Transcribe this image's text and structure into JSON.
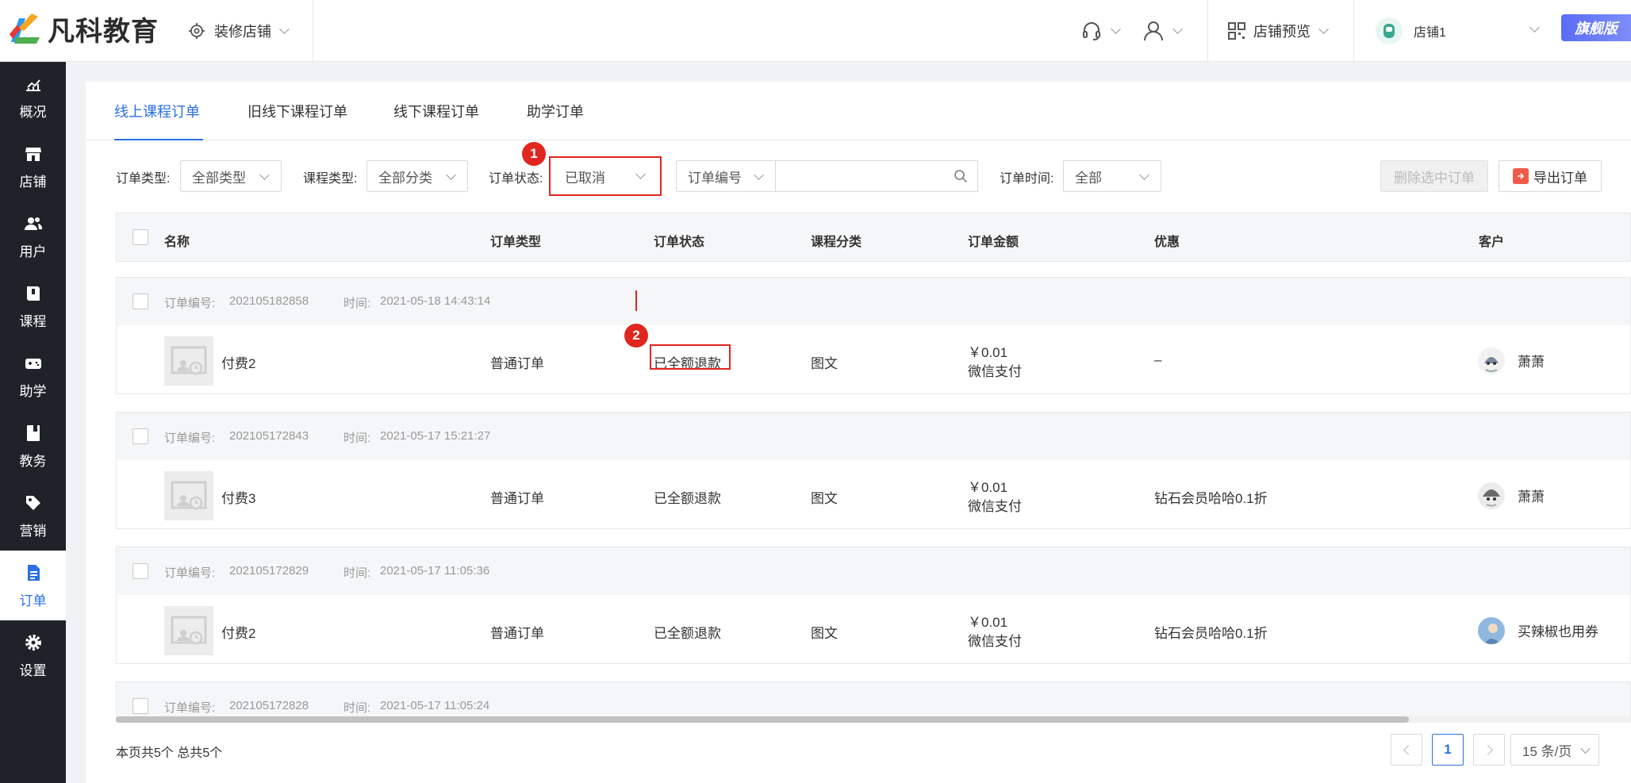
{
  "header": {
    "brand": "凡科教育",
    "decorate_label": "装修店铺",
    "store_preview_label": "店铺预览",
    "store_name": "店铺1",
    "edition_badge": "旗舰版"
  },
  "sidebar": {
    "items": [
      {
        "label": "概况",
        "icon": "chart-icon"
      },
      {
        "label": "店铺",
        "icon": "store-icon"
      },
      {
        "label": "用户",
        "icon": "users-icon"
      },
      {
        "label": "课程",
        "icon": "book-icon"
      },
      {
        "label": "助学",
        "icon": "gamepad-icon"
      },
      {
        "label": "教务",
        "icon": "notebook-icon"
      },
      {
        "label": "营销",
        "icon": "tag-icon"
      },
      {
        "label": "订单",
        "icon": "document-icon"
      },
      {
        "label": "设置",
        "icon": "gear-icon"
      }
    ],
    "active": "订单"
  },
  "tabs": [
    "线上课程订单",
    "旧线下课程订单",
    "线下课程订单",
    "助学订单"
  ],
  "filters": {
    "order_type_label": "订单类型:",
    "order_type_value": "全部类型",
    "course_type_label": "课程类型:",
    "course_type_value": "全部分类",
    "order_status_label": "订单状态:",
    "order_status_value": "已取消",
    "search_field_value": "订单编号",
    "order_time_label": "订单时间:",
    "order_time_value": "全部",
    "delete_button": "删除选中订单",
    "export_button": "导出订单"
  },
  "annotations": {
    "marker1": "1",
    "marker2": "2"
  },
  "table": {
    "columns": [
      "名称",
      "订单类型",
      "订单状态",
      "课程分类",
      "订单金额",
      "优惠",
      "客户"
    ],
    "order_no_label": "订单编号:",
    "time_label": "时间:",
    "rows": [
      {
        "order_no": "202105182858",
        "time": "2021-05-18 14:43:14",
        "name": "付费2",
        "type": "普通订单",
        "status": "已全额退款",
        "category": "图文",
        "amount": "￥0.01",
        "payment": "微信支付",
        "discount": "–",
        "customer": "萧萧"
      },
      {
        "order_no": "202105172843",
        "time": "2021-05-17 15:21:27",
        "name": "付费3",
        "type": "普通订单",
        "status": "已全额退款",
        "category": "图文",
        "amount": "￥0.01",
        "payment": "微信支付",
        "discount": "钻石会员哈哈0.1折",
        "customer": "萧萧"
      },
      {
        "order_no": "202105172829",
        "time": "2021-05-17 11:05:36",
        "name": "付费2",
        "type": "普通订单",
        "status": "已全额退款",
        "category": "图文",
        "amount": "￥0.01",
        "payment": "微信支付",
        "discount": "钻石会员哈哈0.1折",
        "customer": "买辣椒也用券"
      },
      {
        "order_no": "202105172828",
        "time": "2021-05-17 11:05:24"
      }
    ]
  },
  "footer": {
    "summary": "本页共5个 总共5个",
    "current_page": "1",
    "page_size": "15 条/页"
  }
}
